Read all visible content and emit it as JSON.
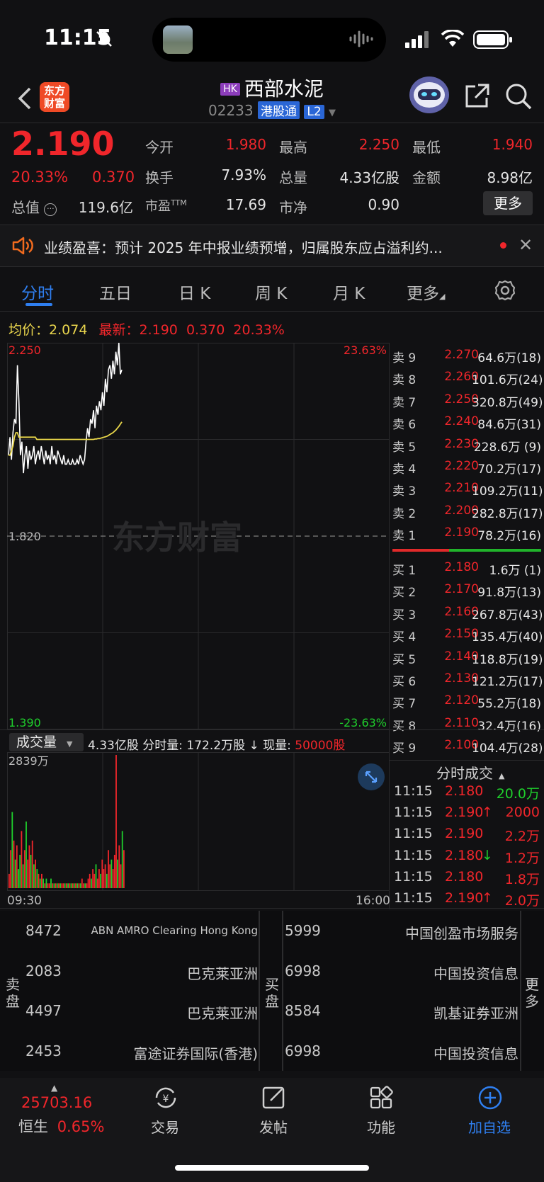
{
  "status": {
    "time": "11:15"
  },
  "header": {
    "logo_line1": "东方",
    "logo_line2": "财富",
    "market_badge": "HK",
    "stock_name": "西部水泥",
    "stock_code": "02233",
    "connect_tag": "港股通",
    "level_tag": "L2"
  },
  "quote": {
    "price": "2.190",
    "change_pct": "20.33%",
    "change": "0.370",
    "mcap_label": "总值",
    "mcap_value": "119.6亿",
    "fields": [
      {
        "label": "今开",
        "value": "1.980",
        "color": "#f0262b"
      },
      {
        "label": "最高",
        "value": "2.250",
        "color": "#f0262b"
      },
      {
        "label": "最低",
        "value": "1.940",
        "color": "#f0262b"
      },
      {
        "label": "换手",
        "value": "7.93%",
        "color": "#e6e6e6"
      },
      {
        "label": "总量",
        "value": "4.33亿股",
        "color": "#e6e6e6"
      },
      {
        "label": "金额",
        "value": "8.98亿",
        "color": "#e6e6e6"
      },
      {
        "label": "市盈",
        "sup": "TTM",
        "value": "17.69",
        "color": "#e6e6e6"
      },
      {
        "label": "市净",
        "value": "0.90",
        "color": "#e6e6e6"
      }
    ],
    "more_label": "更多"
  },
  "notice": {
    "text": "业绩盈喜：预计 2025 年中报业绩预增，归属股东应占溢利约..."
  },
  "tabs": [
    "分时",
    "五日",
    "日 K",
    "周 K",
    "月 K",
    "更多"
  ],
  "avg_row": {
    "avg_label": "均价：",
    "avg_value": "2.074",
    "latest_label": "最新：",
    "latest_value": "2.190",
    "latest_change": "0.370",
    "latest_pct": "20.33%"
  },
  "chart_data": {
    "type": "line",
    "ylim": [
      1.39,
      2.25
    ],
    "prev_close": 1.82,
    "y_labels": {
      "top": "2.250",
      "middle": "1.820",
      "bottom": "1.390"
    },
    "pct_labels": {
      "top": "23.63%",
      "bottom": "-23.63%"
    },
    "x_labels": [
      "09:30",
      "16:00"
    ],
    "watermark": "东方财富",
    "series": [
      {
        "values": [
          2.0,
          2.04,
          1.99,
          2.05,
          2.08,
          2.07,
          2.2,
          2.12,
          2.0,
          2.03,
          1.96,
          2.0,
          2.02,
          1.97,
          2.01,
          1.99,
          2.0,
          2.02,
          1.98,
          2.0,
          2.01,
          1.99,
          2.02,
          2.0,
          1.98,
          2.01,
          1.99,
          2.0,
          1.98,
          2.02,
          1.99,
          2.0,
          1.98,
          2.01,
          2.0,
          1.99,
          1.98,
          2.0,
          1.98,
          1.98,
          1.99,
          1.98,
          1.98,
          1.99,
          1.98,
          1.98,
          1.99,
          1.98,
          2.0,
          1.99,
          1.98,
          1.99,
          2.03,
          2.06,
          2.04,
          2.08,
          2.07,
          2.1,
          2.06,
          2.11,
          2.09,
          2.12,
          2.1,
          2.14,
          2.11,
          2.17,
          2.14,
          2.19,
          2.2,
          2.17,
          2.21,
          2.18,
          2.23,
          2.2,
          2.25,
          2.18,
          2.19
        ]
      },
      {
        "values": [
          2.0,
          2.0,
          2.01,
          2.02,
          2.04,
          2.05,
          2.05,
          2.04,
          2.04,
          2.04,
          2.04,
          2.04,
          2.04,
          2.04,
          2.04,
          2.04,
          2.04,
          2.04,
          2.04,
          2.035,
          2.035,
          2.035,
          2.035,
          2.035,
          2.035,
          2.035,
          2.035,
          2.035,
          2.035,
          2.035,
          2.035,
          2.035,
          2.035,
          2.035,
          2.035,
          2.035,
          2.035,
          2.035,
          2.035,
          2.035,
          2.035,
          2.035,
          2.035,
          2.035,
          2.035,
          2.035,
          2.035,
          2.035,
          2.035,
          2.035,
          2.035,
          2.035,
          2.035,
          2.035,
          2.035,
          2.035,
          2.035,
          2.035,
          2.036,
          2.036,
          2.037,
          2.037,
          2.038,
          2.039,
          2.04,
          2.041,
          2.042,
          2.044,
          2.046,
          2.048,
          2.05,
          2.053,
          2.056,
          2.06,
          2.064,
          2.069,
          2.074
        ]
      }
    ],
    "volume": {
      "label": "成交量",
      "total": "4.33亿股",
      "fenshi_label": "分时量:",
      "fenshi_value": "172.2万股",
      "current_label": "现量:",
      "current_value": "50000股",
      "max_label": "2839万",
      "values": [
        3,
        8,
        16,
        10,
        6,
        9,
        4,
        7,
        12,
        5,
        8,
        14,
        6,
        9,
        7,
        10,
        5,
        6,
        4,
        3,
        2,
        3,
        2,
        1,
        2,
        1,
        1,
        2,
        1,
        1,
        1,
        1,
        1,
        1,
        1,
        1,
        1,
        1,
        1,
        1,
        1,
        1,
        1,
        1,
        1,
        1,
        1,
        2,
        1,
        1,
        1,
        2,
        3,
        2,
        4,
        3,
        5,
        2,
        4,
        3,
        6,
        4,
        5,
        3,
        8,
        5,
        6,
        4,
        7,
        28,
        6,
        9,
        5,
        12,
        8
      ],
      "colors": [
        "r",
        "r",
        "g",
        "r",
        "g",
        "r",
        "g",
        "g",
        "r",
        "g",
        "r",
        "g",
        "r",
        "r",
        "g",
        "r",
        "g",
        "r",
        "g",
        "r",
        "g",
        "r",
        "g",
        "r",
        "g",
        "r",
        "r",
        "g",
        "r",
        "g",
        "r",
        "g",
        "r",
        "g",
        "r",
        "r",
        "g",
        "r",
        "g",
        "r",
        "g",
        "r",
        "g",
        "r",
        "g",
        "r",
        "g",
        "r",
        "r",
        "g",
        "r",
        "r",
        "r",
        "g",
        "r",
        "r",
        "g",
        "r",
        "r",
        "g",
        "r",
        "r",
        "r",
        "g",
        "r",
        "r",
        "g",
        "r",
        "r",
        "r",
        "g",
        "r",
        "r",
        "g",
        "r"
      ]
    }
  },
  "order_book": {
    "asks": [
      {
        "label": "卖 9",
        "price": "2.270",
        "vol": "64.6万(18)"
      },
      {
        "label": "卖 8",
        "price": "2.260",
        "vol": "101.6万(24)"
      },
      {
        "label": "卖 7",
        "price": "2.250",
        "vol": "320.8万(49)"
      },
      {
        "label": "卖 6",
        "price": "2.240",
        "vol": "84.6万(31)"
      },
      {
        "label": "卖 5",
        "price": "2.230",
        "vol": "228.6万 (9)"
      },
      {
        "label": "卖 4",
        "price": "2.220",
        "vol": "70.2万(17)"
      },
      {
        "label": "卖 3",
        "price": "2.210",
        "vol": "109.2万(11)"
      },
      {
        "label": "卖 2",
        "price": "2.200",
        "vol": "282.8万(17)"
      },
      {
        "label": "卖 1",
        "price": "2.190",
        "vol": "78.2万(16)"
      }
    ],
    "bids": [
      {
        "label": "买 1",
        "price": "2.180",
        "vol": "1.6万 (1)"
      },
      {
        "label": "买 2",
        "price": "2.170",
        "vol": "91.8万(13)"
      },
      {
        "label": "买 3",
        "price": "2.160",
        "vol": "267.8万(43)"
      },
      {
        "label": "买 4",
        "price": "2.150",
        "vol": "135.4万(40)"
      },
      {
        "label": "买 5",
        "price": "2.140",
        "vol": "118.8万(19)"
      },
      {
        "label": "买 6",
        "price": "2.130",
        "vol": "121.2万(17)"
      },
      {
        "label": "买 7",
        "price": "2.120",
        "vol": "55.2万(18)"
      },
      {
        "label": "买 8",
        "price": "2.110",
        "vol": "32.4万(16)"
      },
      {
        "label": "买 9",
        "price": "2.100",
        "vol": "104.4万(28)"
      }
    ]
  },
  "ticks": {
    "header": "分时成交",
    "rows": [
      {
        "time": "11:15",
        "price": "2.180",
        "arrow": "",
        "vol": "20.0万",
        "vol_color": "#1fcf2c"
      },
      {
        "time": "11:15",
        "price": "2.190",
        "arrow": "↑",
        "vol": "2000",
        "vol_color": "#f0262b"
      },
      {
        "time": "11:15",
        "price": "2.190",
        "arrow": "",
        "vol": "2.2万",
        "vol_color": "#f0262b"
      },
      {
        "time": "11:15",
        "price": "2.180",
        "arrow": "↓",
        "vol": "1.2万",
        "vol_color": "#f0262b"
      },
      {
        "time": "11:15",
        "price": "2.180",
        "arrow": "",
        "vol": "1.8万",
        "vol_color": "#f0262b"
      },
      {
        "time": "11:15",
        "price": "2.190",
        "arrow": "↑",
        "vol": "2.0万",
        "vol_color": "#f0262b"
      }
    ]
  },
  "brokers": {
    "sell_label": "卖盘",
    "buy_label": "买盘",
    "more_label": "更多",
    "sell": [
      {
        "num": "8472",
        "name": "ABN AMRO Clearing Hong Kong"
      },
      {
        "num": "2083",
        "name": "巴克莱亚洲"
      },
      {
        "num": "4497",
        "name": "巴克莱亚洲"
      },
      {
        "num": "2453",
        "name": "富途证券国际(香港)"
      }
    ],
    "buy": [
      {
        "num": "5999",
        "name": "中国创盈市场服务"
      },
      {
        "num": "6998",
        "name": "中国投资信息"
      },
      {
        "num": "8584",
        "name": "凯基证券亚洲"
      },
      {
        "num": "6998",
        "name": "中国投资信息"
      }
    ]
  },
  "bottom_nav": {
    "index_value": "25703.16",
    "index_name": "恒生",
    "index_pct": "0.65%",
    "items": [
      "交易",
      "发帖",
      "功能",
      "加自选"
    ]
  }
}
